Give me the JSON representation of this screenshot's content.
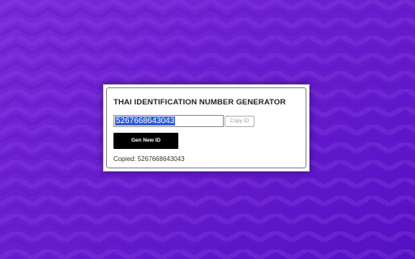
{
  "colors": {
    "background": "#6a1fcf",
    "selection": "#2e5ad6",
    "button": "#000000"
  },
  "generator": {
    "title": "THAI IDENTIFICATION NUMBER GENERATOR",
    "id_value": "5267668643043",
    "copy_label": "Copy ID",
    "generate_label": "Gen New ID",
    "status_text": "Copied: 5267668643043"
  }
}
